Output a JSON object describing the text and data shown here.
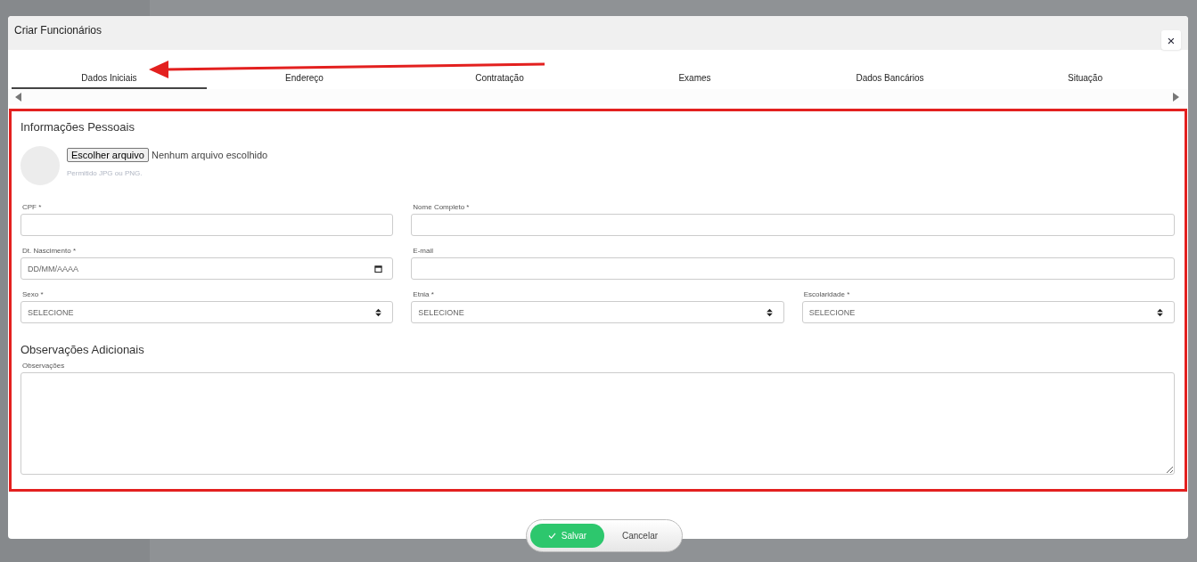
{
  "dialog": {
    "title": "Criar Funcionários",
    "close_label": "×"
  },
  "tabs": [
    {
      "label": "Dados Iniciais",
      "selected": true
    },
    {
      "label": "Endereço",
      "selected": false
    },
    {
      "label": "Contratação",
      "selected": false
    },
    {
      "label": "Exames",
      "selected": false
    },
    {
      "label": "Dados Bancários",
      "selected": false
    },
    {
      "label": "Situação",
      "selected": false
    }
  ],
  "personal_section": {
    "heading": "Informações Pessoais",
    "photo_upload": {
      "button": "Escolher arquivo",
      "status": "Nenhum arquivo escolhido",
      "hint": "Permitido JPG ou PNG."
    },
    "rows": [
      [
        {
          "kind": "text",
          "label": "CPF *"
        },
        {
          "kind": "text",
          "label": "Nome Completo *"
        }
      ],
      [
        {
          "kind": "date",
          "label": "Dt. Nascimento *",
          "placeholder": "DD/MM/AAAA"
        },
        {
          "kind": "text",
          "label": "E-mail"
        }
      ],
      [
        {
          "kind": "select",
          "label": "Sexo *",
          "value": "SELECIONE"
        },
        {
          "kind": "select",
          "label": "Etnia *",
          "value": "SELECIONE"
        },
        {
          "kind": "select",
          "label": "Escolaridade *",
          "value": "SELECIONE"
        }
      ]
    ]
  },
  "notes_section": {
    "heading": "Observações Adicionais",
    "field": {
      "kind": "textarea",
      "label": "Observações"
    }
  },
  "actions": {
    "save": "Salvar",
    "cancel": "Cancelar"
  }
}
